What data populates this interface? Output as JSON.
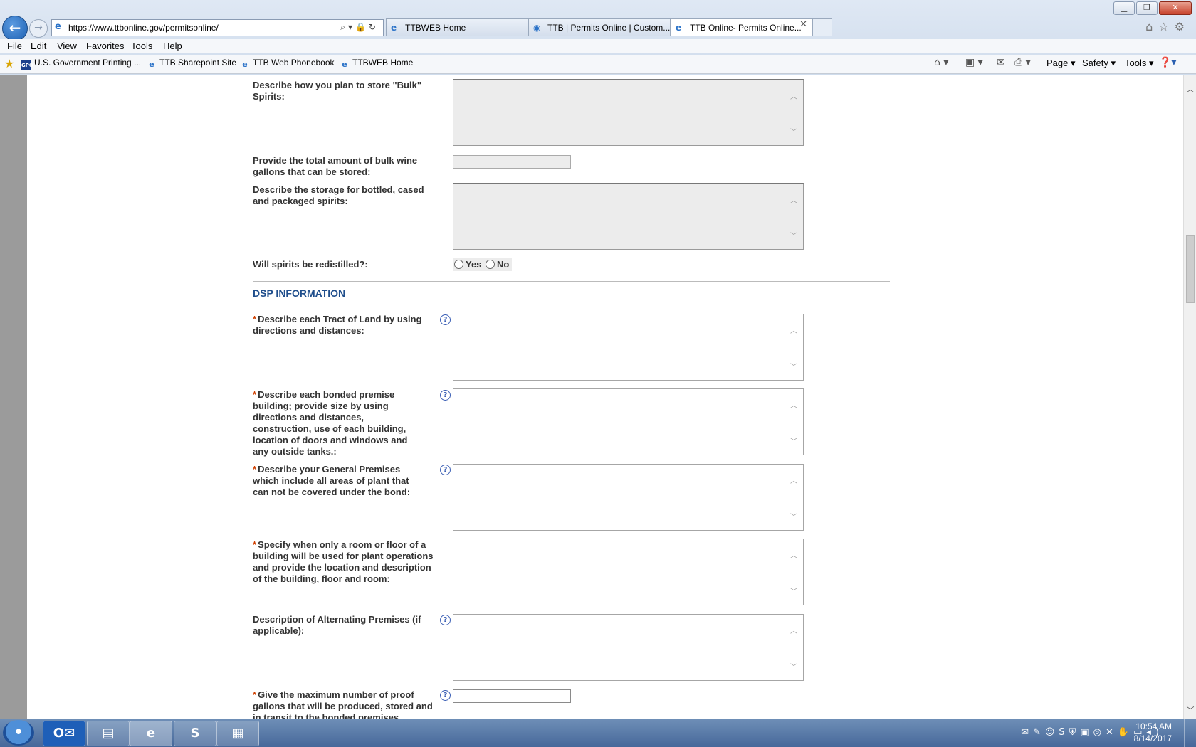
{
  "browser": {
    "url": "https://www.ttbonline.gov/permitsonline/",
    "tabs": [
      {
        "label": "TTBWEB Home"
      },
      {
        "label": "TTB | Permits Online | Custom..."
      },
      {
        "label": "TTB Online- Permits Online..."
      }
    ],
    "menu": [
      "File",
      "Edit",
      "View",
      "Favorites",
      "Tools",
      "Help"
    ],
    "favorites": [
      "U.S. Government Printing ...",
      "TTB Sharepoint Site",
      "TTB Web Phonebook",
      "TTBWEB Home"
    ],
    "commands": {
      "page": "Page ▾",
      "safety": "Safety ▾",
      "tools": "Tools ▾"
    }
  },
  "form": {
    "bulk_spirits_label": "Describe how you plan to store \"Bulk\" Spirits:",
    "bulk_wine_label": "Provide the total amount of bulk wine gallons that can be stored:",
    "bottled_storage_label": "Describe the storage for bottled, cased and packaged spirits:",
    "redistilled_label": "Will spirits be redistilled?:",
    "redistilled_options": {
      "yes": "Yes",
      "no": "No"
    },
    "section_title": "DSP INFORMATION",
    "required_mark": "*",
    "tract_label": "Describe each Tract of Land by using directions and distances:",
    "bonded_label": "Describe each bonded premise building; provide size by using directions and distances, construction, use of each building, location of doors and windows and any outside tanks.:",
    "general_label": "Describe your General Premises which include all areas of plant that can not be covered under the bond:",
    "room_floor_label": "Specify when only a room or floor of a building will be used for plant operations and provide the location and description of the building, floor and room:",
    "alternating_label": "Description of Alternating Premises (if applicable):",
    "max_proof_label": "Give the maximum number of proof gallons that will be produced, stored and in transit to the bonded premises"
  },
  "taskbar": {
    "time": "10:54 AM",
    "date": "8/14/2017"
  },
  "colors": {
    "section_title": "#1f4e8c",
    "required": "#d04000",
    "help": "#3b5fb5"
  }
}
